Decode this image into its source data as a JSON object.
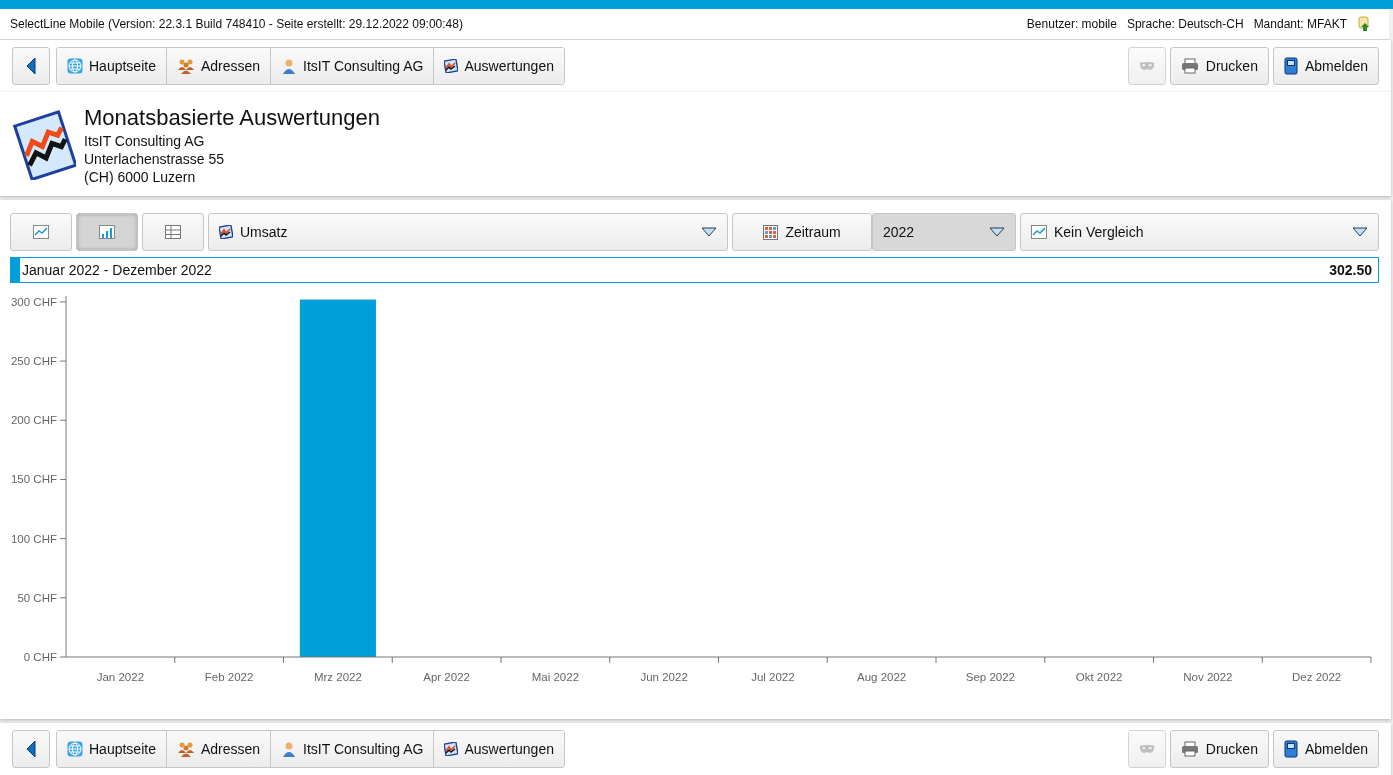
{
  "header": {
    "app_info": "SelectLine Mobile (Version: 22.3.1 Build 748410 - Seite erstellt: 29.12.2022 09:00:48)",
    "user": "Benutzer: mobile",
    "language": "Sprache: Deutsch-CH",
    "client": "Mandant: MFAKT"
  },
  "toolbars": [
    {
      "breadcrumbs": [
        {
          "kind": "globe",
          "label": "Hauptseite"
        },
        {
          "kind": "group",
          "label": "Adressen"
        },
        {
          "kind": "person",
          "label": "ItsIT Consulting AG"
        },
        {
          "kind": "chart",
          "label": "Auswertungen"
        }
      ],
      "buttons": [
        {
          "kind": "mask",
          "disabled": true
        },
        {
          "kind": "print",
          "label": "Drucken",
          "disabled": false
        },
        {
          "kind": "logout",
          "label": "Abmelden",
          "disabled": false
        }
      ]
    },
    {
      "breadcrumbs": [
        {
          "kind": "globe",
          "label": "Hauptseite"
        },
        {
          "kind": "group",
          "label": "Adressen"
        },
        {
          "kind": "person",
          "label": "ItsIT Consulting AG"
        },
        {
          "kind": "chart",
          "label": "Auswertungen"
        }
      ],
      "buttons": [
        {
          "kind": "mask",
          "disabled": true
        },
        {
          "kind": "print",
          "label": "Drucken",
          "disabled": false
        },
        {
          "kind": "logout",
          "label": "Abmelden",
          "disabled": false
        }
      ]
    }
  ],
  "page": {
    "title": "Monatsbasierte Auswertungen",
    "company": "ItsIT Consulting AG",
    "street": "Unterlachenstrasse 55",
    "city": "(CH) 6000 Luzern"
  },
  "controls": {
    "views": [
      {
        "kind": "line",
        "selected": false
      },
      {
        "kind": "bar",
        "selected": true
      },
      {
        "kind": "table",
        "selected": false
      }
    ],
    "metric": "Umsatz",
    "period_button": "Zeitraum",
    "year": "2022",
    "comparison": "Kein Vergleich"
  },
  "range": {
    "label": "Januar 2022 - Dezember 2022",
    "total": "302.50"
  },
  "chart_data": {
    "type": "bar",
    "categories": [
      "Jan 2022",
      "Feb 2022",
      "Mrz 2022",
      "Apr 2022",
      "Mai 2022",
      "Jun 2022",
      "Jul 2022",
      "Aug 2022",
      "Sep 2022",
      "Okt 2022",
      "Nov 2022",
      "Dez 2022"
    ],
    "series": [
      {
        "color": "#009fda",
        "values": [
          0,
          0,
          302,
          0,
          0,
          0,
          0,
          0,
          0,
          0,
          0,
          0
        ]
      }
    ],
    "ylim": [
      0,
      305
    ],
    "yticks": [
      {
        "value": 0,
        "label": "0 CHF"
      },
      {
        "value": 50,
        "label": "50 CHF"
      },
      {
        "value": 100,
        "label": "100 CHF"
      },
      {
        "value": 150,
        "label": "150 CHF"
      },
      {
        "value": 200,
        "label": "200 CHF"
      },
      {
        "value": 250,
        "label": "250 CHF"
      },
      {
        "value": 300,
        "label": "300 CHF"
      }
    ]
  }
}
